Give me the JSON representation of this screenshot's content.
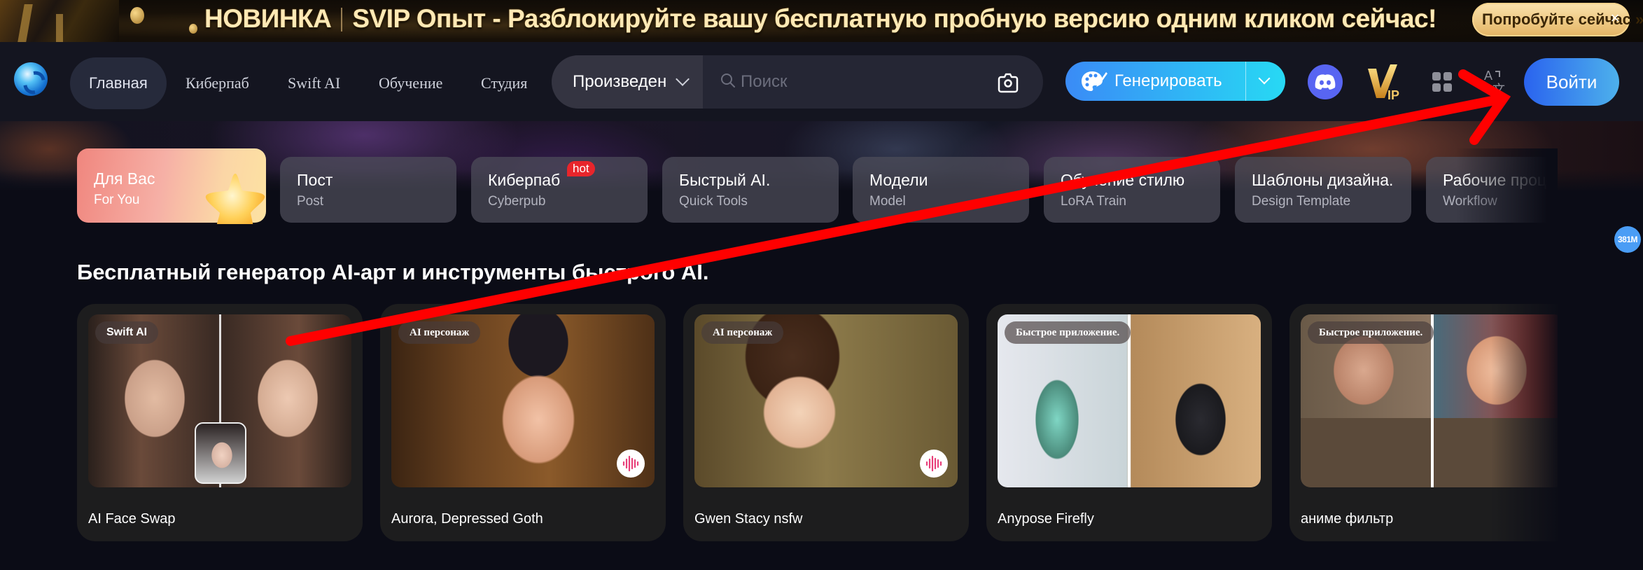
{
  "promo": {
    "badge": "НОВИНКА",
    "text": "SVIP Опыт - Разблокируйте вашу бесплатную пробную версию одним кликом сейчас!",
    "cta_label": "Попробуйте сейчас »",
    "close_icon": "×"
  },
  "nav": {
    "items": [
      {
        "label": "Главная",
        "active": true
      },
      {
        "label": "Киберпаб",
        "active": false
      },
      {
        "label": "Swift AI",
        "active": false
      },
      {
        "label": "Обучение",
        "active": false
      },
      {
        "label": "Студия",
        "active": false
      }
    ],
    "search": {
      "type_selected": "Произведен",
      "placeholder": "Поиск",
      "value": ""
    },
    "generate_label": "Генерировать",
    "vip_label": "VIP",
    "login_label": "Войти"
  },
  "tabs": [
    {
      "title": "Для Вас",
      "subtitle": "For You",
      "active": true
    },
    {
      "title": "Пост",
      "subtitle": "Post"
    },
    {
      "title": "Киберпаб",
      "subtitle": "Cyberpub",
      "badge": "hot"
    },
    {
      "title": "Быстрый AI.",
      "subtitle": "Quick Tools"
    },
    {
      "title": "Модели",
      "subtitle": "Model"
    },
    {
      "title": "Обучение стилю",
      "subtitle": "LoRA Train"
    },
    {
      "title": "Шаблоны дизайна.",
      "subtitle": "Design Template"
    },
    {
      "title": "Рабочие процессы",
      "subtitle": "Workflow"
    }
  ],
  "counter_badge": "381M",
  "section": {
    "title": "Бесплатный генератор AI-арт и инструменты быстрого AI.",
    "cards": [
      {
        "tag": "Swift AI",
        "title": "AI Face Swap",
        "voice": false
      },
      {
        "tag": "AI персонаж",
        "title": "Aurora, Depressed Goth",
        "voice": true
      },
      {
        "tag": "AI персонаж",
        "title": "Gwen Stacy nsfw",
        "voice": true
      },
      {
        "tag": "Быстрое приложение.",
        "title": "Anypose Firefly",
        "voice": false
      },
      {
        "tag": "Быстрое приложение.",
        "title": "аниме фильтр",
        "voice": false
      }
    ]
  },
  "annotation": {
    "color": "#ff0000",
    "type": "arrow"
  }
}
